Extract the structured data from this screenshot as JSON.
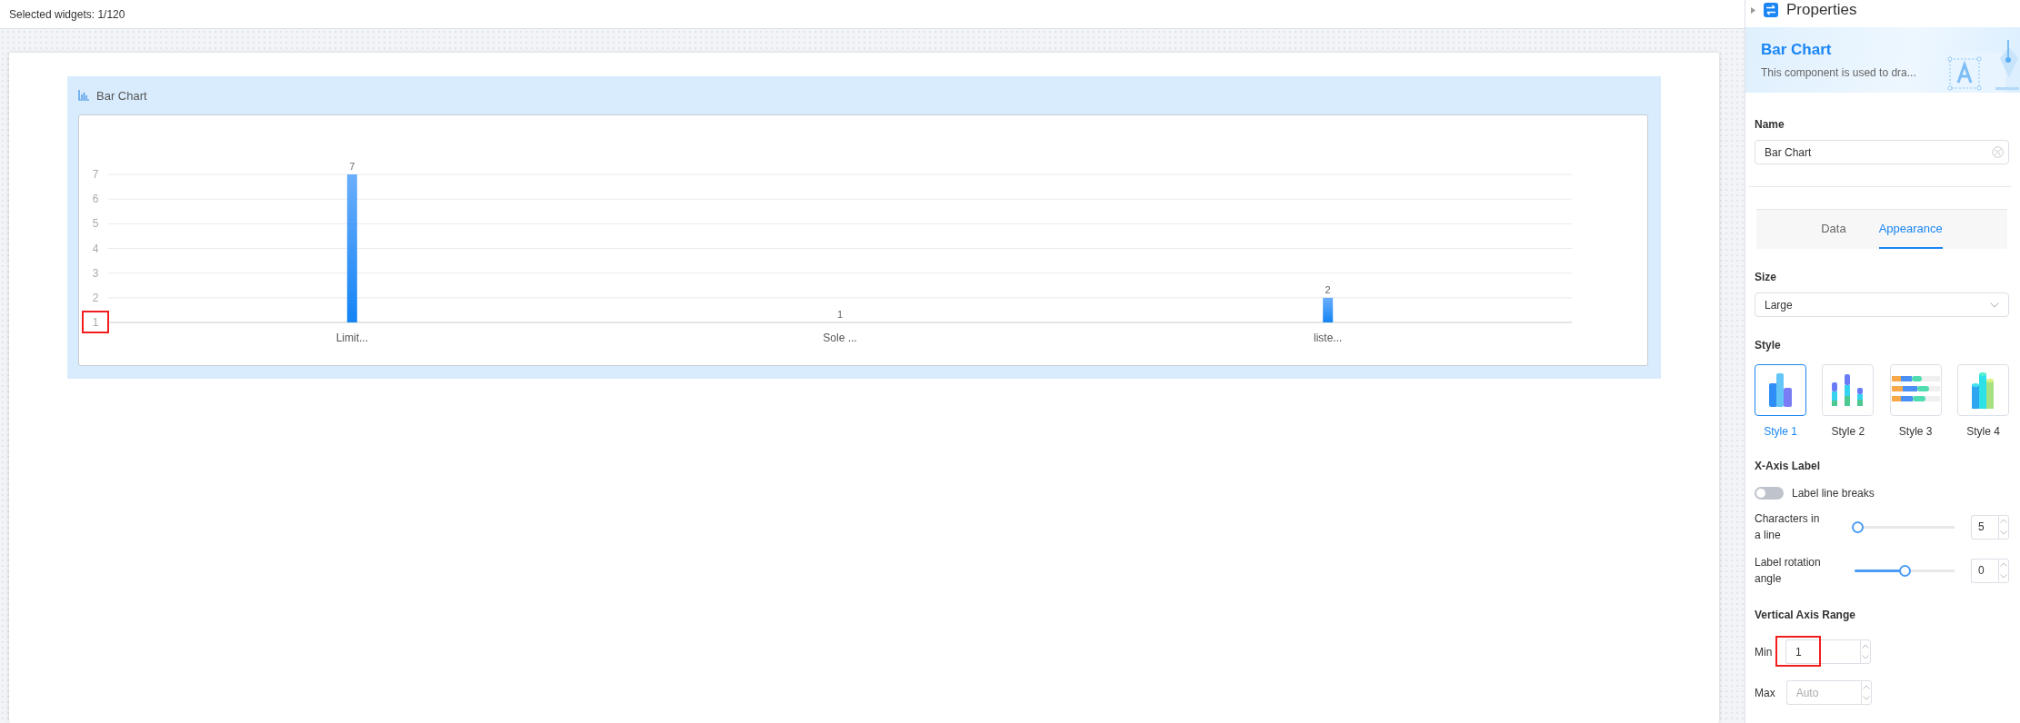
{
  "status_bar": {
    "selected_widgets": "Selected widgets: 1/120"
  },
  "widget": {
    "title": "Bar Chart",
    "chart_data": {
      "type": "bar",
      "categories": [
        "Limit...",
        "Sole ...",
        "liste..."
      ],
      "values": [
        7,
        1,
        2
      ],
      "ylim": [
        1,
        7
      ],
      "yticks": [
        1,
        2,
        3,
        4,
        5,
        6,
        7
      ],
      "data_labels": true,
      "grid": true
    }
  },
  "properties": {
    "title": "Properties",
    "banner": {
      "title": "Bar Chart",
      "description": "This component is used to dra..."
    },
    "name": {
      "label": "Name",
      "value": "Bar Chart"
    },
    "tabs": [
      {
        "label": "Data",
        "selected": false
      },
      {
        "label": "Appearance",
        "selected": true
      }
    ],
    "size": {
      "label": "Size",
      "value": "Large"
    },
    "style": {
      "label": "Style",
      "options": [
        {
          "label": "Style 1",
          "kind": "grouped",
          "selected": true
        },
        {
          "label": "Style 2",
          "kind": "stacked",
          "selected": false
        },
        {
          "label": "Style 3",
          "kind": "horizontal",
          "selected": false
        },
        {
          "label": "Style 4",
          "kind": "cubes",
          "selected": false
        }
      ]
    },
    "x_axis_label": {
      "label": "X-Axis Label",
      "line_breaks": {
        "label": "Label line breaks",
        "on": false
      },
      "sliders": [
        {
          "label": "Characters in a line",
          "level": 0.03,
          "value": "5"
        },
        {
          "label": "Label rotation angle",
          "level": 0.5,
          "value": "0"
        }
      ]
    },
    "vertical_axis_range": {
      "label": "Vertical Axis Range",
      "min": {
        "label": "Min",
        "value": "1"
      },
      "max": {
        "label": "Max",
        "placeholder": "Auto"
      }
    }
  }
}
